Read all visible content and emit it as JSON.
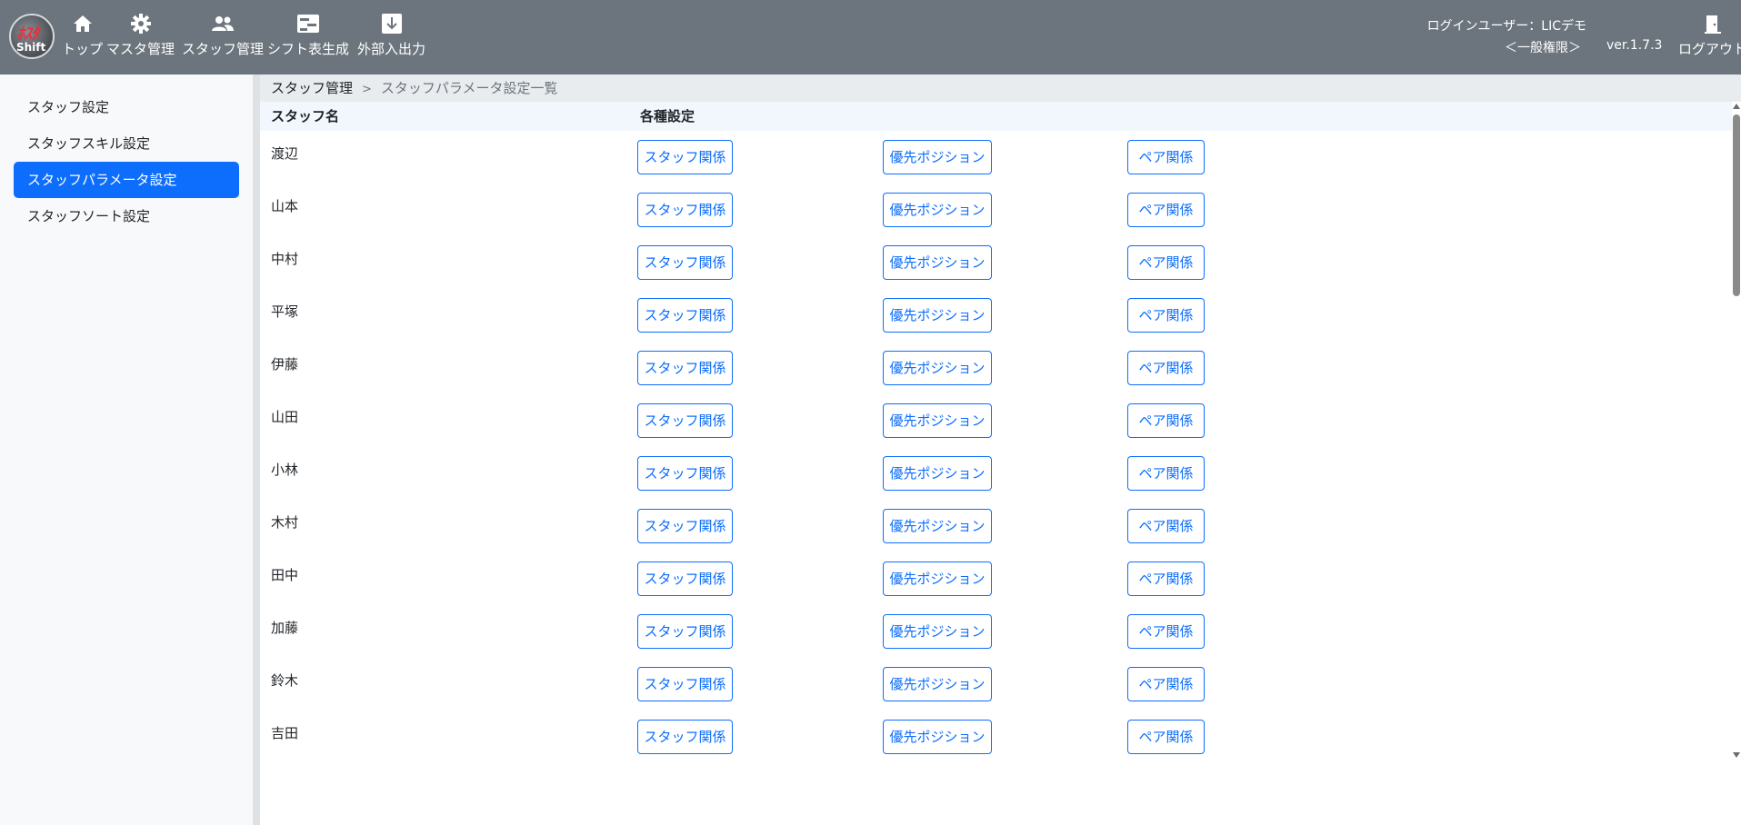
{
  "header": {
    "logo": {
      "line1": "ﾎｽﾀ",
      "line2": "Shift"
    },
    "nav": [
      {
        "label": "トップ",
        "icon": "home-icon"
      },
      {
        "label": "マスタ管理",
        "icon": "gear-icon"
      },
      {
        "label": "スタッフ管理",
        "icon": "users-icon"
      },
      {
        "label": "シフト表生成",
        "icon": "table-icon"
      },
      {
        "label": "外部入出力",
        "icon": "download-icon"
      }
    ],
    "user_label": "ログインユーザー：LICデモ",
    "role": "＜一般権限＞",
    "version": "ver.1.7.3",
    "logout": {
      "label": "ログアウト",
      "icon": "door-icon"
    }
  },
  "sidebar": {
    "items": [
      {
        "label": "スタッフ設定",
        "active": false
      },
      {
        "label": "スタッフスキル設定",
        "active": false
      },
      {
        "label": "スタッフパラメータ設定",
        "active": true
      },
      {
        "label": "スタッフソート設定",
        "active": false
      }
    ]
  },
  "breadcrumb": {
    "parent": "スタッフ管理",
    "separator": ">",
    "current": "スタッフパラメータ設定一覧"
  },
  "table": {
    "headers": [
      "スタッフ名",
      "各種設定"
    ],
    "button_labels": [
      "スタッフ関係",
      "優先ポジション",
      "ペア関係"
    ],
    "rows": [
      "渡辺",
      "山本",
      "中村",
      "平塚",
      "伊藤",
      "山田",
      "小林",
      "木村",
      "田中",
      "加藤",
      "鈴木",
      "吉田"
    ]
  },
  "colors": {
    "header_bg": "#6c757d",
    "accent": "#0d6efd",
    "table_header_bg": "#f1f7fd",
    "breadcrumb_bg": "#e9ecef"
  }
}
